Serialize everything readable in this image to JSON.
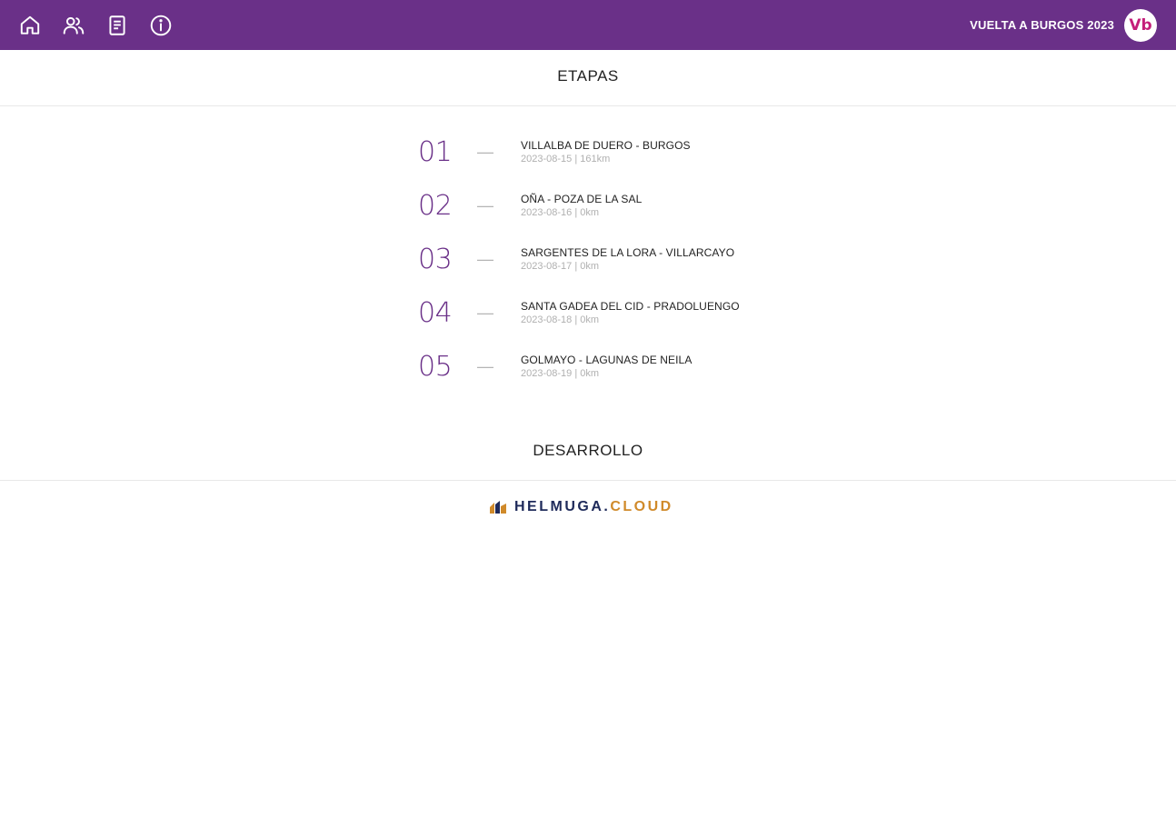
{
  "header": {
    "nav_icons": [
      "home-icon",
      "users-icon",
      "document-icon",
      "info-icon"
    ],
    "title": "VUELTA A BURGOS 2023",
    "logo_text": "Vb",
    "background_color": "#6a3088"
  },
  "etapas": {
    "title": "ETAPAS",
    "stages": [
      {
        "number": "01",
        "name": "VILLALBA DE DUERO - BURGOS",
        "meta": "2023-08-15 | 161km"
      },
      {
        "number": "02",
        "name": "OÑA - POZA DE LA SAL",
        "meta": "2023-08-16 | 0km"
      },
      {
        "number": "03",
        "name": "SARGENTES DE LA LORA - VILLARCAYO",
        "meta": "2023-08-17 | 0km"
      },
      {
        "number": "04",
        "name": "SANTA GADEA DEL CID - PRADOLUENGO",
        "meta": "2023-08-18 | 0km"
      },
      {
        "number": "05",
        "name": "GOLMAYO - LAGUNAS DE NEILA",
        "meta": "2023-08-19 | 0km"
      }
    ],
    "dash": "—"
  },
  "desarrollo": {
    "title": "DESARROLLO",
    "brand_main": "HELMUGA.",
    "brand_suffix": "CLOUD"
  },
  "colors": {
    "accent": "#6a3088",
    "logo_pink": "#c41f7a",
    "helmuga_navy": "#1e2a5a",
    "helmuga_orange": "#d08a2a"
  }
}
